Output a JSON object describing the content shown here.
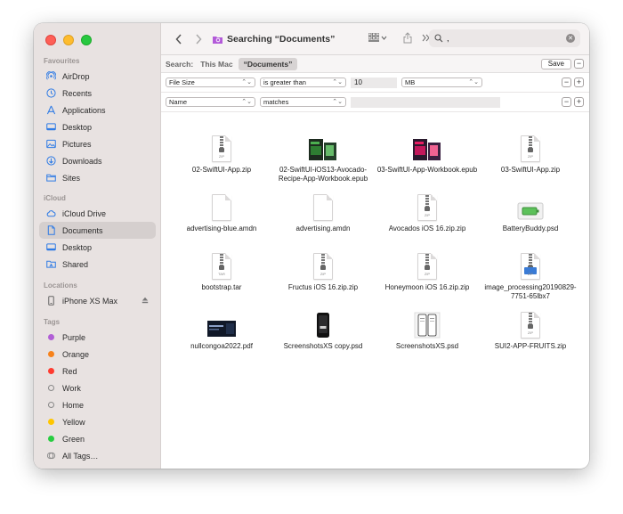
{
  "toolbar": {
    "title": "Searching “Documents”",
    "search_value": ","
  },
  "sidebar": {
    "favourites_heading": "Favourites",
    "favourites": [
      {
        "label": "AirDrop",
        "icon": "airdrop-icon"
      },
      {
        "label": "Recents",
        "icon": "clock-icon"
      },
      {
        "label": "Applications",
        "icon": "applications-icon"
      },
      {
        "label": "Desktop",
        "icon": "desktop-icon"
      },
      {
        "label": "Pictures",
        "icon": "pictures-icon"
      },
      {
        "label": "Downloads",
        "icon": "download-icon"
      },
      {
        "label": "Sites",
        "icon": "folder-icon"
      }
    ],
    "icloud_heading": "iCloud",
    "icloud": [
      {
        "label": "iCloud Drive",
        "icon": "cloud-icon"
      },
      {
        "label": "Documents",
        "icon": "document-icon",
        "active": true
      },
      {
        "label": "Desktop",
        "icon": "desktop-icon"
      },
      {
        "label": "Shared",
        "icon": "shared-folder-icon"
      }
    ],
    "locations_heading": "Locations",
    "locations": [
      {
        "label": "iPhone XS Max",
        "icon": "phone-icon"
      }
    ],
    "tags_heading": "Tags",
    "tags": [
      {
        "label": "Purple",
        "color": "#b15fd6"
      },
      {
        "label": "Orange",
        "color": "#f7821b"
      },
      {
        "label": "Red",
        "color": "#ff3b30"
      },
      {
        "label": "Work",
        "color": ""
      },
      {
        "label": "Home",
        "color": ""
      },
      {
        "label": "Yellow",
        "color": "#ffc600"
      },
      {
        "label": "Green",
        "color": "#28cd41"
      },
      {
        "label": "All Tags…",
        "color": "all"
      }
    ]
  },
  "searchbar": {
    "label": "Search:",
    "scope_this_mac": "This Mac",
    "scope_documents": "“Documents”",
    "save_label": "Save",
    "minus": "−",
    "plus": "+"
  },
  "criteria": [
    {
      "attribute": "File Size",
      "operator": "is greater than",
      "value": "10",
      "unit": "MB"
    },
    {
      "attribute": "Name",
      "operator": "matches",
      "value": ""
    }
  ],
  "files": [
    {
      "name": "02-SwiftUI-App.zip",
      "kind": "zip"
    },
    {
      "name": "02-SwiftUI-iOS13-Avocado-Recipe-App-Workbook.epub",
      "kind": "epub-green"
    },
    {
      "name": "03-SwiftUI-App-Workbook.epub",
      "kind": "epub-pink"
    },
    {
      "name": "03-SwiftUI-App.zip",
      "kind": "zip"
    },
    {
      "name": "advertising-blue.amdn",
      "kind": "doc"
    },
    {
      "name": "advertising.amdn",
      "kind": "doc"
    },
    {
      "name": "Avocados iOS 16.zip.zip",
      "kind": "zip"
    },
    {
      "name": "BatteryBuddy.psd",
      "kind": "psd-battery"
    },
    {
      "name": "bootstrap.tar",
      "kind": "tar"
    },
    {
      "name": "Fructus iOS 16.zip.zip",
      "kind": "zip"
    },
    {
      "name": "Honeymoon iOS 16.zip.zip",
      "kind": "zip"
    },
    {
      "name": "image_processing20190829-7751-65lbx7",
      "kind": "zip-blue"
    },
    {
      "name": "nullcongoa2022.pdf",
      "kind": "pdf"
    },
    {
      "name": "ScreenshotsXS copy.psd",
      "kind": "psd-phone"
    },
    {
      "name": "ScreenshotsXS.psd",
      "kind": "psd-phones"
    },
    {
      "name": "SUI2-APP-FRUITS.zip",
      "kind": "zip"
    }
  ]
}
